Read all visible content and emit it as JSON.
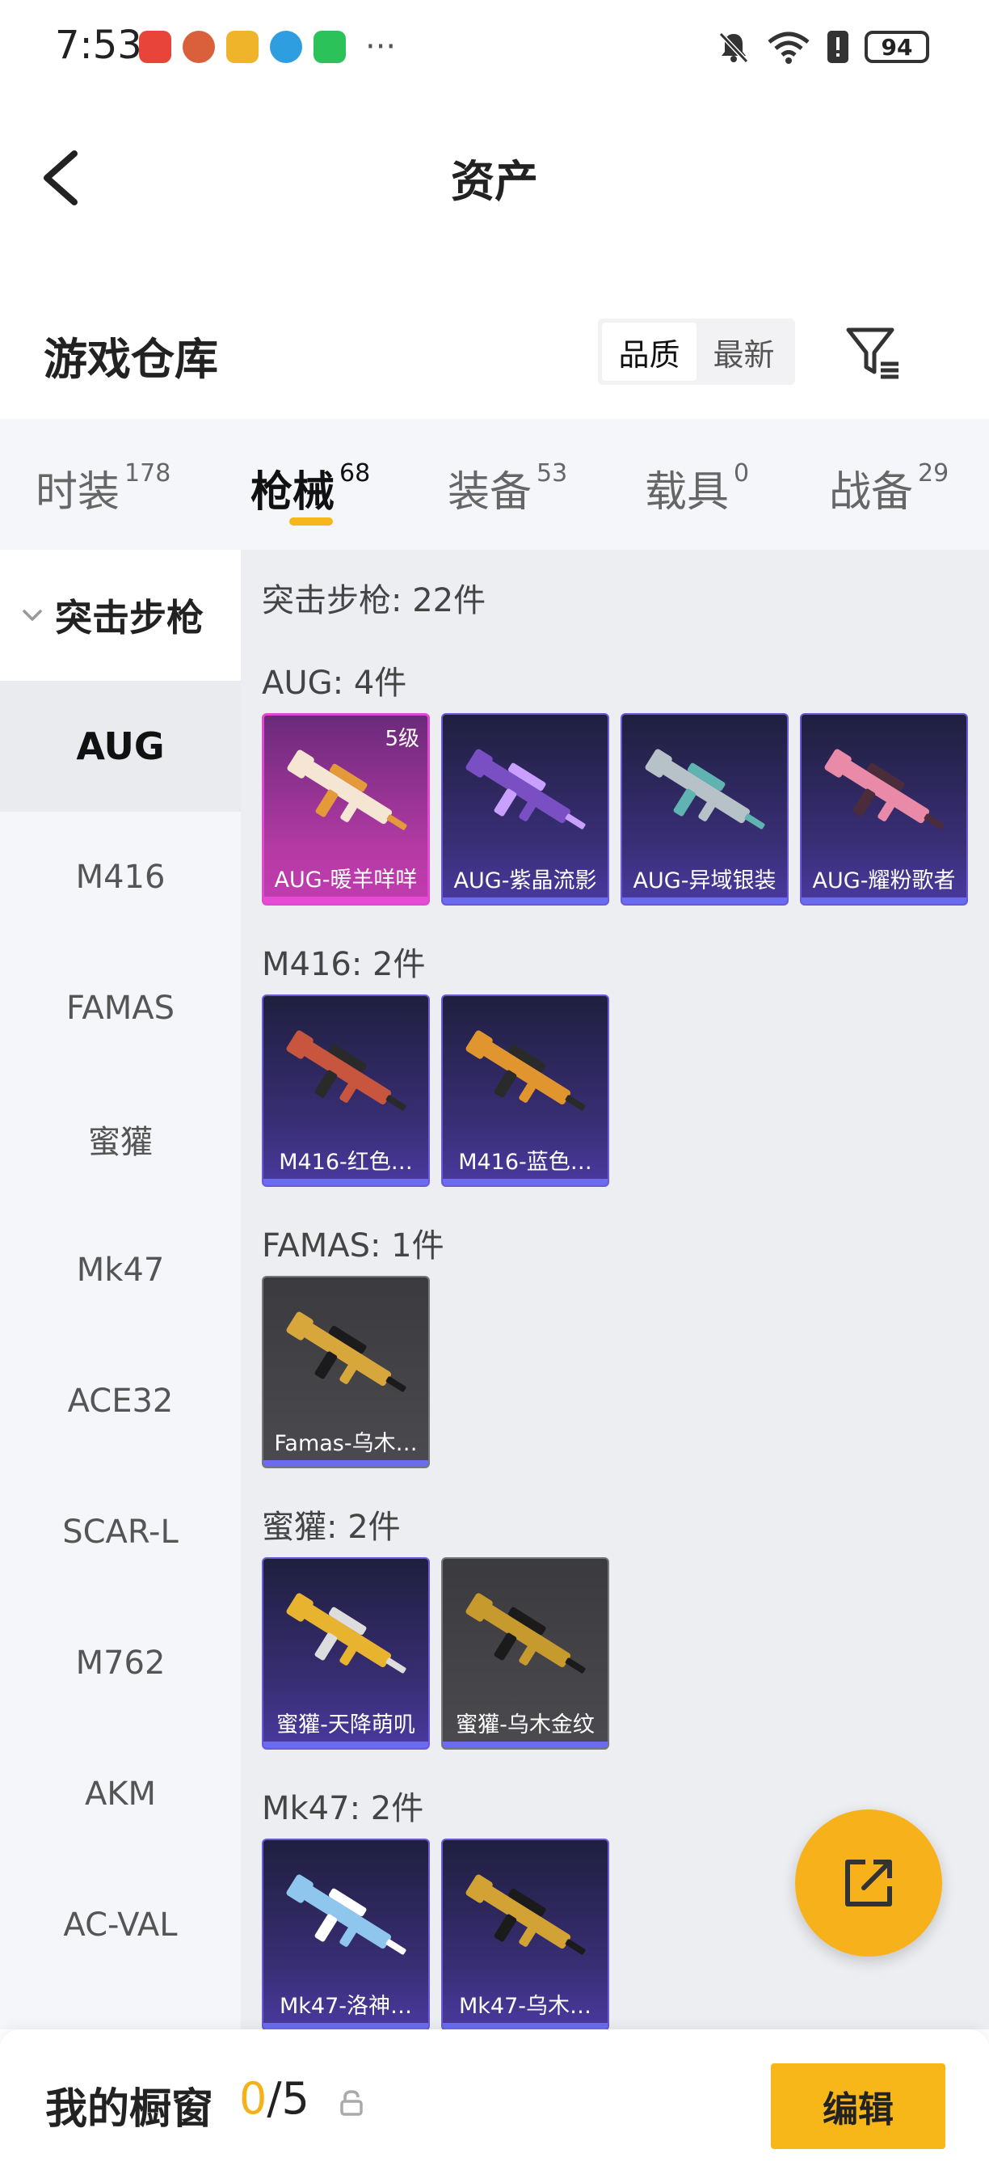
{
  "status_bar": {
    "time": "7:53",
    "battery": "94",
    "more": "···"
  },
  "header": {
    "title": "资产"
  },
  "warehouse": {
    "title": "游戏仓库",
    "sort_options": [
      "品质",
      "最新"
    ],
    "active_sort": "品质"
  },
  "tabs": [
    {
      "label": "时装",
      "count": "178"
    },
    {
      "label": "枪械",
      "count": "68"
    },
    {
      "label": "装备",
      "count": "53"
    },
    {
      "label": "载具",
      "count": "0"
    },
    {
      "label": "战备",
      "count": "29"
    }
  ],
  "active_tab": "枪械",
  "sidebar": {
    "group": "突击步枪",
    "items": [
      "AUG",
      "M416",
      "FAMAS",
      "蜜獾",
      "Mk47",
      "ACE32",
      "SCAR-L",
      "M762",
      "AKM",
      "AC-VAL"
    ],
    "active": "AUG"
  },
  "content": {
    "total": "突击步枪: 22件",
    "sections": [
      {
        "title": "AUG: 4件",
        "items": [
          {
            "name": "AUG-暖羊咩咩",
            "level": "5级",
            "rarity": "pink",
            "gun_color": "#f4e6d2",
            "accent": "#e59a3a"
          },
          {
            "name": "AUG-紫晶流影",
            "rarity": "purple",
            "gun_color": "#7a4fc4",
            "accent": "#c9a0ff"
          },
          {
            "name": "AUG-异域银装",
            "rarity": "purple",
            "gun_color": "#b7c2c8",
            "accent": "#5fb3b0"
          },
          {
            "name": "AUG-耀粉歌者",
            "rarity": "purple",
            "gun_color": "#e88aa8",
            "accent": "#4a2c3a"
          }
        ]
      },
      {
        "title": "M416: 2件",
        "items": [
          {
            "name": "M416-红色…",
            "rarity": "purple",
            "gun_color": "#c8553e",
            "accent": "#2a2a2a"
          },
          {
            "name": "M416-蓝色…",
            "rarity": "purple",
            "gun_color": "#e0952e",
            "accent": "#2a2a2a"
          }
        ]
      },
      {
        "title": "FAMAS: 1件",
        "items": [
          {
            "name": "Famas-乌木…",
            "rarity": "gray",
            "gun_color": "#d8a73c",
            "accent": "#1b1b1b"
          }
        ]
      },
      {
        "title": "蜜獾: 2件",
        "items": [
          {
            "name": "蜜獾-天降萌叽",
            "rarity": "purple",
            "gun_color": "#e8b430",
            "accent": "#ddd"
          },
          {
            "name": "蜜獾-乌木金纹",
            "rarity": "gray",
            "gun_color": "#c79a2e",
            "accent": "#1b1b1b"
          }
        ]
      },
      {
        "title": "Mk47: 2件",
        "items": [
          {
            "name": "Mk47-洛神…",
            "rarity": "purple",
            "gun_color": "#8fc6ee",
            "accent": "#ffffff"
          },
          {
            "name": "Mk47-乌木…",
            "rarity": "purple",
            "gun_color": "#d2a234",
            "accent": "#1b1b1b"
          }
        ]
      }
    ]
  },
  "bottom": {
    "title": "我的橱窗",
    "current": "0",
    "separator": "/5",
    "edit_label": "编辑"
  },
  "colors": {
    "accent": "#f5b71a",
    "rarity_pink": "#e04ad0",
    "rarity_purple": "#6a5ad8"
  },
  "icons": {
    "back": "chevron-left-icon",
    "filter": "filter-icon",
    "share": "share-icon",
    "lock": "lock-icon"
  }
}
